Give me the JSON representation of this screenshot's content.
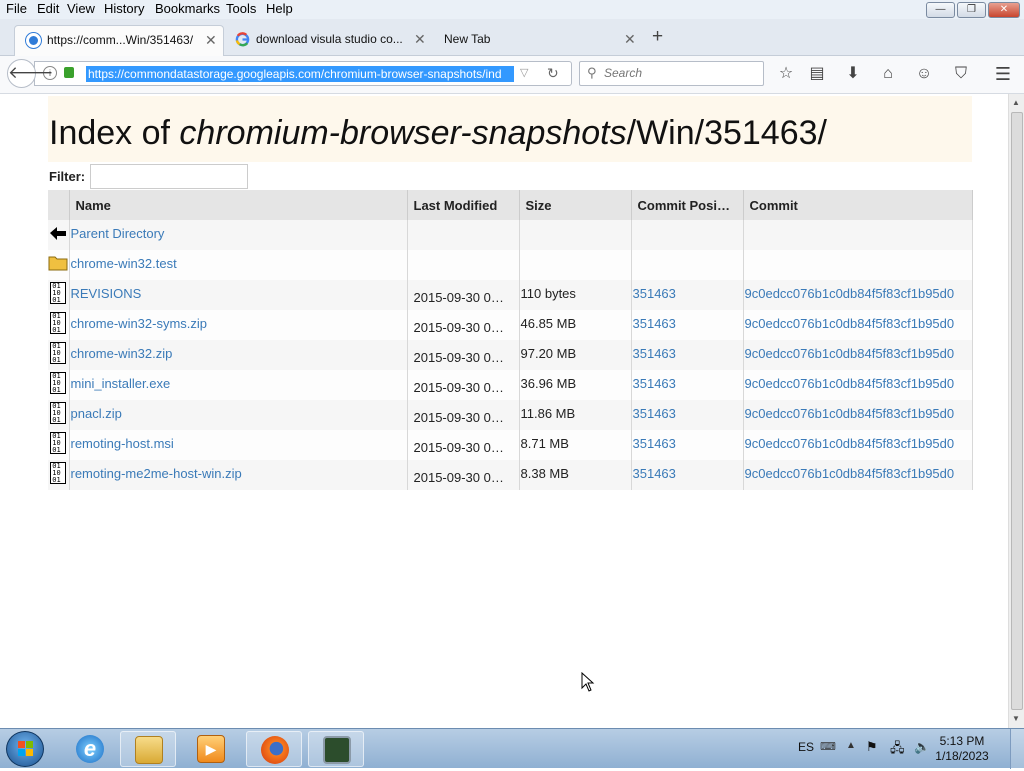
{
  "menubar": {
    "items": [
      "File",
      "Edit",
      "View",
      "History",
      "Bookmarks",
      "Tools",
      "Help"
    ],
    "window_controls": {
      "minimize": "—",
      "restore": "❐",
      "close": "✕"
    }
  },
  "tabs": [
    {
      "label": "https://comm...Win/351463/",
      "active": true,
      "icon": "chromium-storage-icon"
    },
    {
      "label": "download visula studio co...",
      "active": false,
      "icon": "google-icon"
    },
    {
      "label": "New Tab",
      "active": false,
      "icon": "none"
    }
  ],
  "newtab_label": "+",
  "navbar": {
    "url": "https://commondatastorage.googleapis.com/chromium-browser-snapshots/ind",
    "search_placeholder": "Search",
    "icons": [
      "star-icon",
      "reading-list-icon",
      "download-icon",
      "home-icon",
      "chat-icon",
      "pocket-icon",
      "menu-icon"
    ]
  },
  "page": {
    "title_prefix": "Index of ",
    "title_italic": "chromium-browser-snapshots",
    "title_suffix": "/Win/351463/",
    "filter_label": "Filter:",
    "columns": [
      "Name",
      "Last Modified",
      "Size",
      "Commit Posi…",
      "Commit"
    ],
    "rows": [
      {
        "icon": "back-arrow-icon",
        "name": "Parent Directory",
        "date": "",
        "size": "",
        "pos": "",
        "commit": ""
      },
      {
        "icon": "folder-icon",
        "name": "chrome-win32.test",
        "date": "",
        "size": "",
        "pos": "",
        "commit": ""
      },
      {
        "icon": "binary-file-icon",
        "name": "REVISIONS",
        "date": "2015-09-30 0…",
        "size": "110 bytes",
        "pos": "351463",
        "commit": "9c0edcc076b1c0db84f5f83cf1b95d0"
      },
      {
        "icon": "binary-file-icon",
        "name": "chrome-win32-syms.zip",
        "date": "2015-09-30 0…",
        "size": "46.85 MB",
        "pos": "351463",
        "commit": "9c0edcc076b1c0db84f5f83cf1b95d0"
      },
      {
        "icon": "binary-file-icon",
        "name": "chrome-win32.zip",
        "date": "2015-09-30 0…",
        "size": "97.20 MB",
        "pos": "351463",
        "commit": "9c0edcc076b1c0db84f5f83cf1b95d0"
      },
      {
        "icon": "binary-file-icon",
        "name": "mini_installer.exe",
        "date": "2015-09-30 0…",
        "size": "36.96 MB",
        "pos": "351463",
        "commit": "9c0edcc076b1c0db84f5f83cf1b95d0"
      },
      {
        "icon": "binary-file-icon",
        "name": "pnacl.zip",
        "date": "2015-09-30 0…",
        "size": "11.86 MB",
        "pos": "351463",
        "commit": "9c0edcc076b1c0db84f5f83cf1b95d0"
      },
      {
        "icon": "binary-file-icon",
        "name": "remoting-host.msi",
        "date": "2015-09-30 0…",
        "size": "8.71 MB",
        "pos": "351463",
        "commit": "9c0edcc076b1c0db84f5f83cf1b95d0"
      },
      {
        "icon": "binary-file-icon",
        "name": "remoting-me2me-host-win.zip",
        "date": "2015-09-30 0…",
        "size": "8.38 MB",
        "pos": "351463",
        "commit": "9c0edcc076b1c0db84f5f83cf1b95d0"
      }
    ]
  },
  "taskbar": {
    "apps": [
      "ie-icon",
      "explorer-icon",
      "media-player-icon",
      "firefox-icon",
      "task-manager-icon"
    ],
    "language": "ES",
    "time": "5:13 PM",
    "date": "1/18/2023"
  },
  "colors": {
    "link": "#3a7ab8",
    "title_bg": "#fef8ec",
    "url_highlight": "#3399ff",
    "taskbar": "#8fb0d2"
  }
}
